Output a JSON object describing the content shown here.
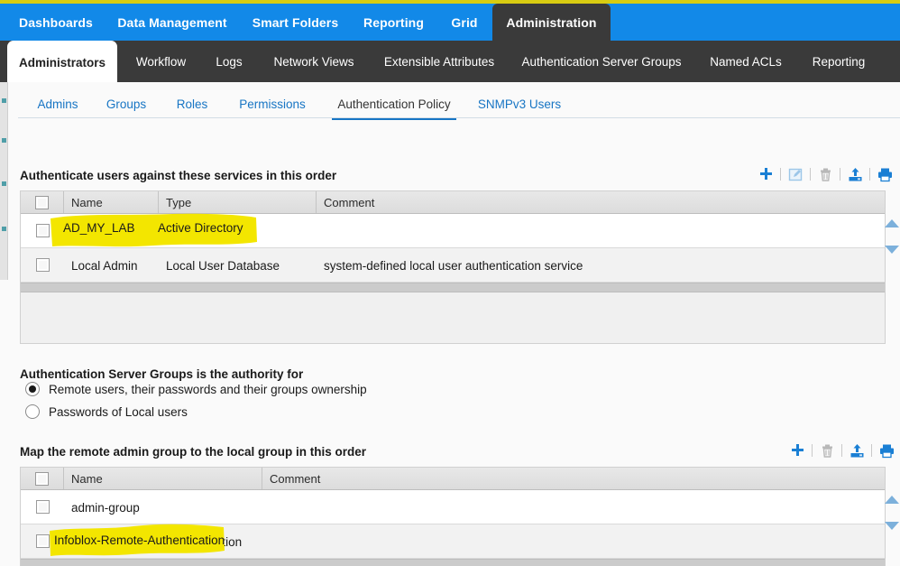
{
  "app": {
    "accent_blue": "#1289e8",
    "dark_bar": "#3a3a3a",
    "link_blue": "#1775c4",
    "highlight_yellow": "#f3e600"
  },
  "nav_primary": {
    "items": [
      {
        "label": "Dashboards",
        "active": false
      },
      {
        "label": "Data Management",
        "active": false
      },
      {
        "label": "Smart Folders",
        "active": false
      },
      {
        "label": "Reporting",
        "active": false
      },
      {
        "label": "Grid",
        "active": false
      },
      {
        "label": "Administration",
        "active": true
      }
    ]
  },
  "nav_secondary": {
    "items": [
      {
        "label": "Administrators",
        "active": true
      },
      {
        "label": "Workflow",
        "active": false
      },
      {
        "label": "Logs",
        "active": false
      },
      {
        "label": "Network Views",
        "active": false
      },
      {
        "label": "Extensible Attributes",
        "active": false
      },
      {
        "label": "Authentication Server Groups",
        "active": false
      },
      {
        "label": "Named ACLs",
        "active": false
      },
      {
        "label": "Reporting",
        "active": false
      }
    ]
  },
  "tabs_tertiary": {
    "items": [
      {
        "label": "Admins",
        "active": false
      },
      {
        "label": "Groups",
        "active": false
      },
      {
        "label": "Roles",
        "active": false
      },
      {
        "label": "Permissions",
        "active": false
      },
      {
        "label": "Authentication Policy",
        "active": true
      },
      {
        "label": "SNMPv3 Users",
        "active": false
      }
    ]
  },
  "services_section": {
    "title": "Authenticate users against these services in this order",
    "toolbar": [
      {
        "icon": "add-icon",
        "label": "Add",
        "enabled": true
      },
      {
        "icon": "edit-icon",
        "label": "Edit",
        "enabled": false
      },
      {
        "icon": "delete-icon",
        "label": "Delete",
        "enabled": false
      },
      {
        "icon": "export-icon",
        "label": "Export",
        "enabled": true
      },
      {
        "icon": "print-icon",
        "label": "Print",
        "enabled": true
      }
    ],
    "columns": [
      "Name",
      "Type",
      "Comment"
    ],
    "rows": [
      {
        "name": "AD_MY_LAB",
        "type": "Active Directory",
        "comment": ""
      },
      {
        "name": "Local Admin",
        "type": "Local User Database",
        "comment": "system-defined local user authentication service"
      }
    ]
  },
  "authority_section": {
    "title": "Authentication Server Groups is the authority for",
    "options": [
      {
        "label": "Remote users, their passwords and their groups ownership",
        "selected": true
      },
      {
        "label": "Passwords of Local users",
        "selected": false
      }
    ]
  },
  "mapping_section": {
    "title": "Map the remote admin group to the local group in this order",
    "toolbar": [
      {
        "icon": "add-icon",
        "label": "Add",
        "enabled": true
      },
      {
        "icon": "delete-icon",
        "label": "Delete",
        "enabled": false
      },
      {
        "icon": "export-icon",
        "label": "Export",
        "enabled": true
      },
      {
        "icon": "print-icon",
        "label": "Print",
        "enabled": true
      }
    ],
    "columns": [
      "Name",
      "Comment"
    ],
    "rows": [
      {
        "name": "admin-group",
        "comment": ""
      },
      {
        "name": "Infoblox-Remote-Authentication",
        "comment": ""
      }
    ]
  },
  "annotations": {
    "highlights": [
      {
        "target": "services row 1 name and type cells",
        "color": "#f3e600"
      },
      {
        "target": "mapping row 2 name cell",
        "color": "#f3e600"
      }
    ]
  }
}
